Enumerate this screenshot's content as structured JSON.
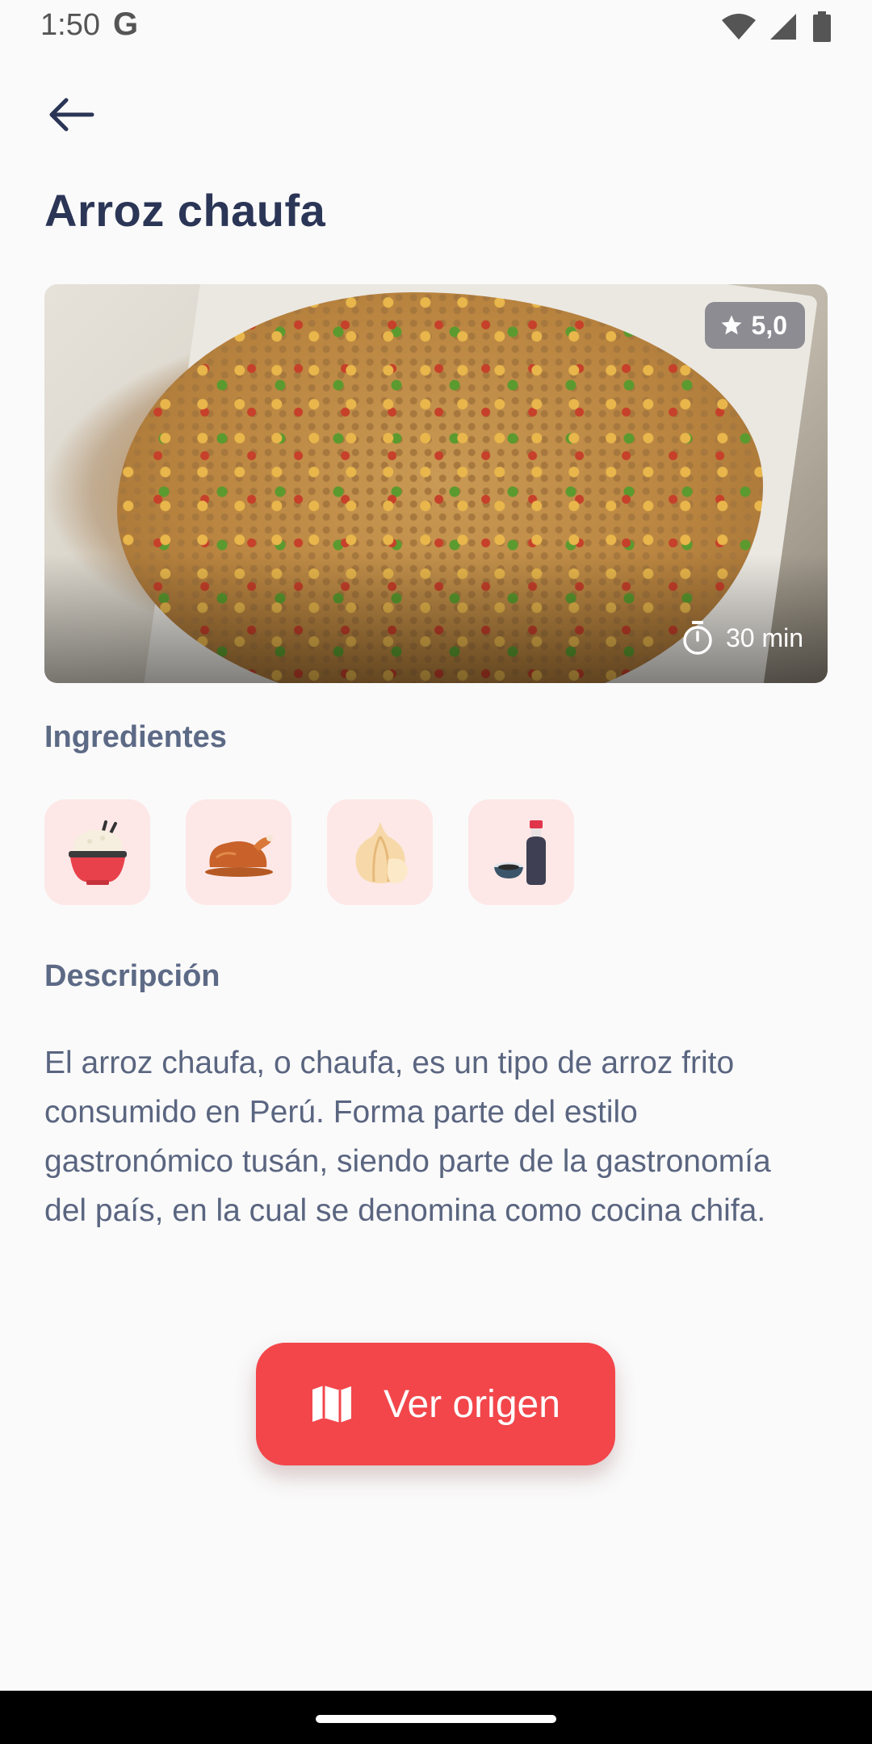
{
  "status_bar": {
    "time": "1:50",
    "google_icon": "G",
    "icons": [
      "wifi-icon",
      "signal-icon",
      "battery-icon"
    ]
  },
  "header": {
    "back_icon": "arrow-left-icon",
    "title": "Arroz chaufa"
  },
  "hero": {
    "rating": "5,0",
    "rating_icon": "star-icon",
    "duration": "30 min",
    "duration_icon": "timer-icon"
  },
  "ingredients": {
    "heading": "Ingredientes",
    "items": [
      {
        "icon": "rice-bowl-icon"
      },
      {
        "icon": "roast-chicken-icon"
      },
      {
        "icon": "garlic-icon"
      },
      {
        "icon": "soy-sauce-icon"
      }
    ]
  },
  "description": {
    "heading": "Descripción",
    "text": "El arroz chaufa, o chaufa, es un tipo de arroz frito consumido en Perú. Forma parte del estilo gastronómico tusán, siendo parte de la gastronomía del país, en la cual se denomina como cocina chifa."
  },
  "cta": {
    "icon": "map-icon",
    "label": "Ver origen"
  },
  "colors": {
    "title": "#2b3556",
    "accent": "#f2464b",
    "tile": "#fde8e7",
    "text": "#5a6580"
  }
}
